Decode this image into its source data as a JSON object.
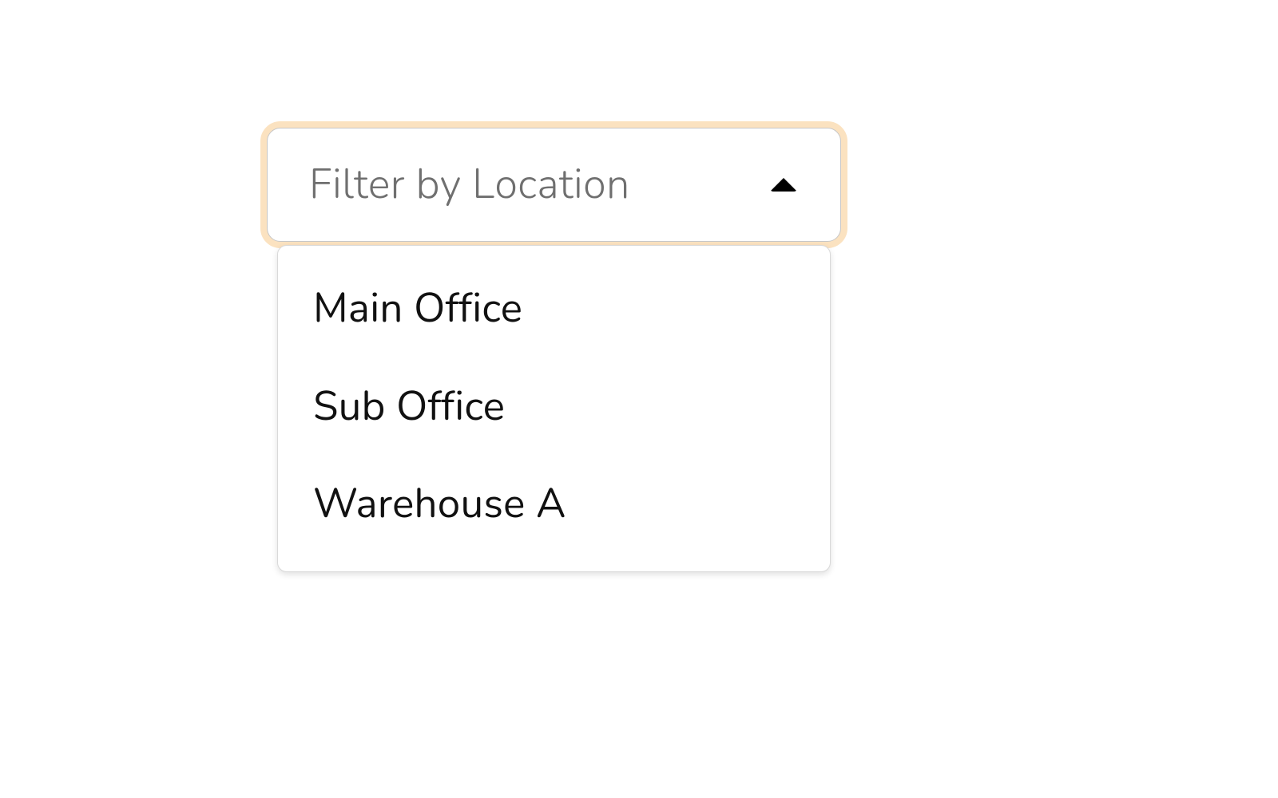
{
  "select": {
    "placeholder": "Filter by Location",
    "options": {
      "0": {
        "label": "Main Office"
      },
      "1": {
        "label": "Sub Office"
      },
      "2": {
        "label": "Warehouse A"
      }
    }
  }
}
